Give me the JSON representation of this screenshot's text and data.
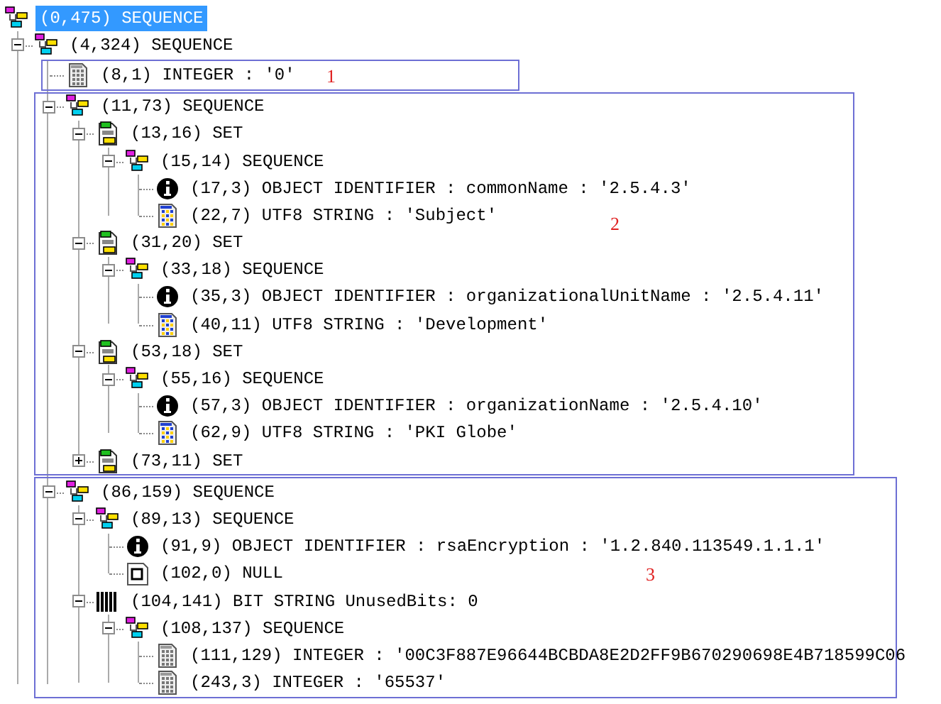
{
  "tree": [
    {
      "label": "(0,475) SEQUENCE",
      "kind": "sequence",
      "selected": true,
      "children": [
        {
          "label": "(4,324) SEQUENCE",
          "kind": "sequence",
          "selected": false,
          "expanded": true,
          "children": [
            {
              "label": "(8,1) INTEGER : '0'",
              "kind": "integer",
              "selected": false,
              "annotation": "1"
            },
            {
              "label": "(11,73) SEQUENCE",
              "kind": "sequence",
              "selected": false,
              "expanded": true,
              "annotation": "2",
              "children": [
                {
                  "label": "(13,16) SET",
                  "kind": "set",
                  "selected": false,
                  "expanded": true,
                  "children": [
                    {
                      "label": "(15,14) SEQUENCE",
                      "kind": "sequence",
                      "selected": false,
                      "expanded": true,
                      "children": [
                        {
                          "label": "(17,3) OBJECT IDENTIFIER : commonName : '2.5.4.3'",
                          "kind": "oid",
                          "selected": false
                        },
                        {
                          "label": "(22,7) UTF8 STRING : 'Subject'",
                          "kind": "string",
                          "selected": false
                        }
                      ]
                    }
                  ]
                },
                {
                  "label": "(31,20) SET",
                  "kind": "set",
                  "selected": false,
                  "expanded": true,
                  "children": [
                    {
                      "label": "(33,18) SEQUENCE",
                      "kind": "sequence",
                      "selected": false,
                      "expanded": true,
                      "children": [
                        {
                          "label": "(35,3) OBJECT IDENTIFIER : organizationalUnitName : '2.5.4.11'",
                          "kind": "oid",
                          "selected": false
                        },
                        {
                          "label": "(40,11) UTF8 STRING : 'Development'",
                          "kind": "string",
                          "selected": false
                        }
                      ]
                    }
                  ]
                },
                {
                  "label": "(53,18) SET",
                  "kind": "set",
                  "selected": false,
                  "expanded": true,
                  "children": [
                    {
                      "label": "(55,16) SEQUENCE",
                      "kind": "sequence",
                      "selected": false,
                      "expanded": true,
                      "children": [
                        {
                          "label": "(57,3) OBJECT IDENTIFIER : organizationName : '2.5.4.10'",
                          "kind": "oid",
                          "selected": false
                        },
                        {
                          "label": "(62,9) UTF8 STRING : 'PKI Globe'",
                          "kind": "string",
                          "selected": false
                        }
                      ]
                    }
                  ]
                },
                {
                  "label": "(73,11) SET",
                  "kind": "set",
                  "selected": false,
                  "expanded": false
                }
              ]
            },
            {
              "label": "(86,159) SEQUENCE",
              "kind": "sequence",
              "selected": false,
              "expanded": true,
              "annotation": "3",
              "children": [
                {
                  "label": "(89,13) SEQUENCE",
                  "kind": "sequence",
                  "selected": false,
                  "expanded": true,
                  "children": [
                    {
                      "label": "(91,9) OBJECT IDENTIFIER : rsaEncryption : '1.2.840.113549.1.1.1'",
                      "kind": "oid",
                      "selected": false
                    },
                    {
                      "label": "(102,0) NULL",
                      "kind": "null",
                      "selected": false
                    }
                  ]
                },
                {
                  "label": "(104,141) BIT STRING UnusedBits: 0",
                  "kind": "bitstring",
                  "selected": false,
                  "expanded": true,
                  "children": [
                    {
                      "label": "(108,137) SEQUENCE",
                      "kind": "sequence",
                      "selected": false,
                      "expanded": true,
                      "children": [
                        {
                          "label": "(111,129) INTEGER : '00C3F887E96644BCBDA8E2D2FF9B670290698E4B718599C06",
                          "kind": "integer",
                          "selected": false
                        },
                        {
                          "label": "(243,3) INTEGER : '65537'",
                          "kind": "integer",
                          "selected": false
                        }
                      ]
                    }
                  ]
                }
              ]
            }
          ]
        }
      ]
    }
  ]
}
